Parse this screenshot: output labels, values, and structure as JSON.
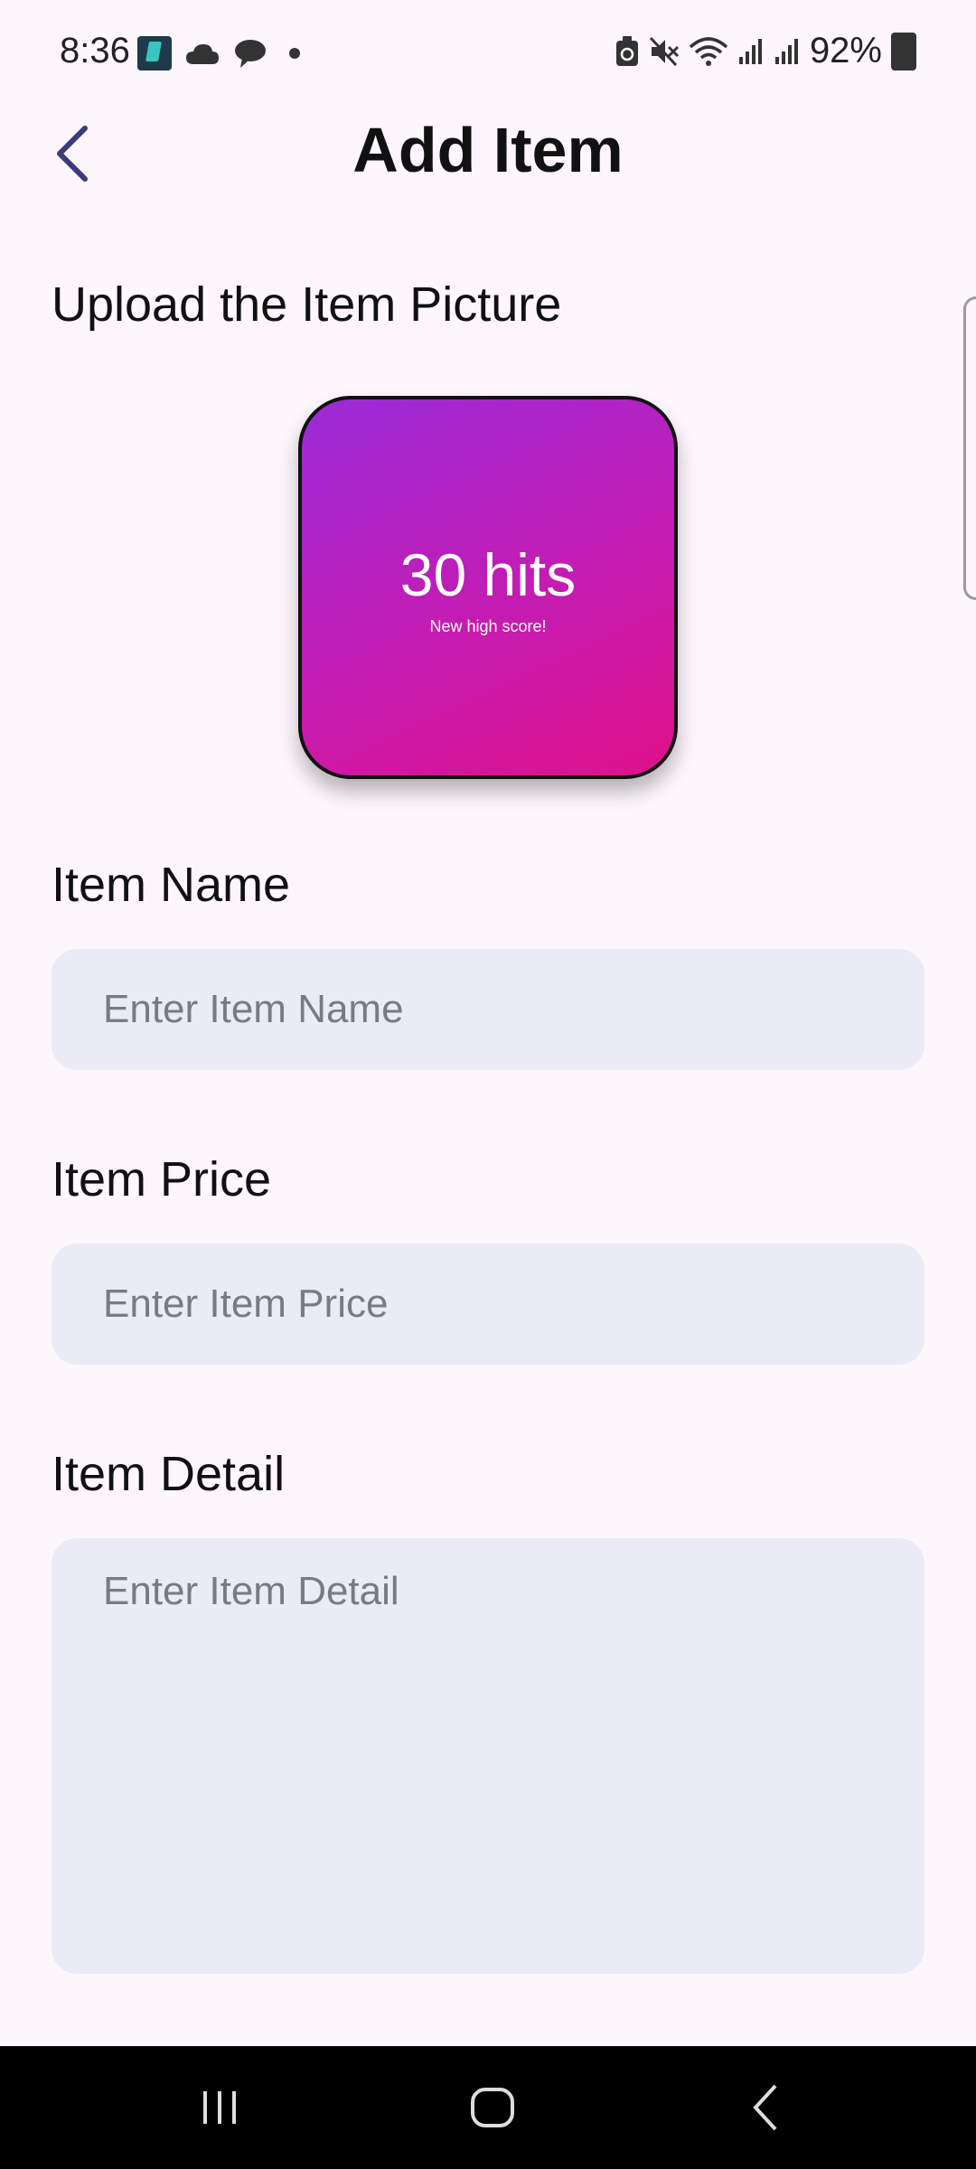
{
  "status_bar": {
    "time": "8:36",
    "battery": "92%",
    "icons": [
      "app-icon",
      "cloud-icon",
      "chat-icon",
      "notification-dot-icon",
      "recycle-icon",
      "mute-icon",
      "wifi-icon",
      "signal-icon",
      "signal-icon",
      "battery-icon"
    ]
  },
  "header": {
    "title": "Add Item",
    "back_icon": "chevron-left-icon"
  },
  "upload": {
    "label": "Upload the Item Picture",
    "preview_main": "30 hits",
    "preview_sub": "New high score!"
  },
  "form": {
    "name_label": "Item Name",
    "name_placeholder": "Enter Item Name",
    "price_label": "Item Price",
    "price_placeholder": "Enter Item Price",
    "detail_label": "Item Detail",
    "detail_placeholder": "Enter Item Detail"
  },
  "nav": {
    "icons": [
      "recent-apps-icon",
      "home-icon",
      "back-icon"
    ]
  },
  "colors": {
    "background": "#fdf7fd",
    "input_background": "#eaebf6",
    "accent_back": "#3b3a7a",
    "gradient_start": "#9b2bd8",
    "gradient_end": "#df1189"
  }
}
